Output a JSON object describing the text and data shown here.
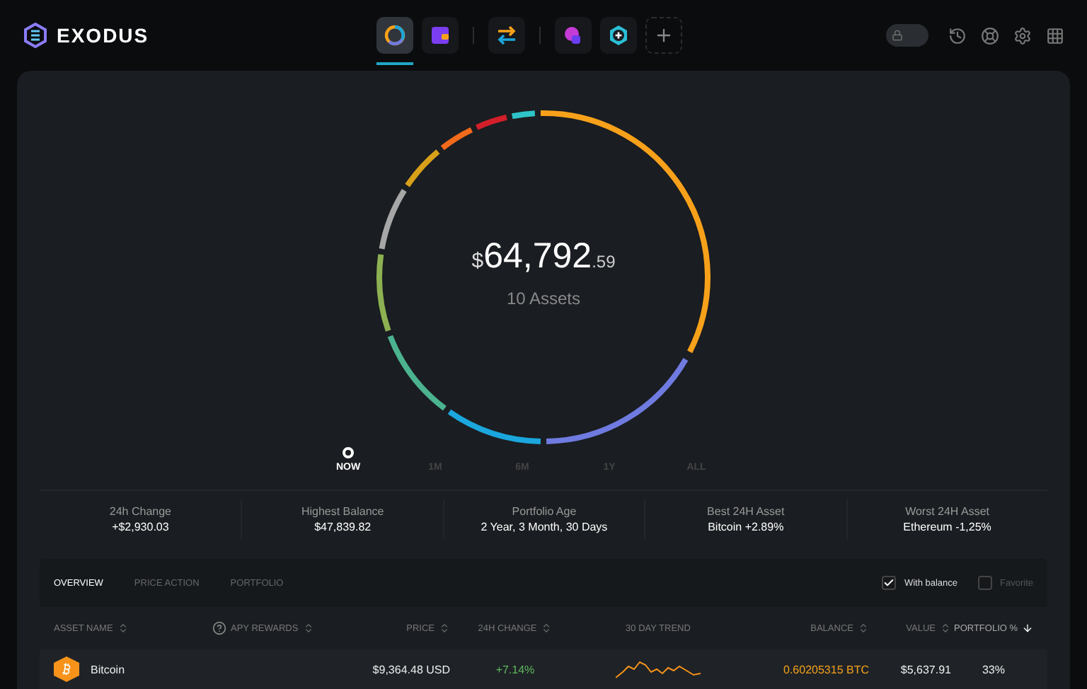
{
  "brand": {
    "name": "EXODUS"
  },
  "nav": [
    {
      "kind": "portfolio",
      "selected": true
    },
    {
      "kind": "wallet",
      "selected": false
    },
    {
      "kind": "divider"
    },
    {
      "kind": "exchange",
      "selected": false
    },
    {
      "kind": "divider"
    },
    {
      "kind": "app-pink",
      "selected": false
    },
    {
      "kind": "app-cyan",
      "selected": false
    },
    {
      "kind": "add"
    }
  ],
  "lock": {
    "on": false
  },
  "portfolio": {
    "currency": "$",
    "whole": "64,792",
    "cents": ".59",
    "assets": "10 Assets"
  },
  "timeline": [
    {
      "label": "NOW",
      "selected": true
    },
    {
      "label": "1M",
      "selected": false
    },
    {
      "label": "6M",
      "selected": false
    },
    {
      "label": "1Y",
      "selected": false
    },
    {
      "label": "ALL",
      "selected": false
    }
  ],
  "stats": [
    {
      "label": "24h Change",
      "value": "+$2,930.03"
    },
    {
      "label": "Highest Balance",
      "value": "$47,839.82"
    },
    {
      "label": "Portfolio Age",
      "value": "2 Year, 3 Month, 30 Days"
    },
    {
      "label": "Best 24H Asset",
      "value": "Bitcoin +2.89%"
    },
    {
      "label": "Worst 24H Asset",
      "value": "Ethereum -1,25%"
    }
  ],
  "table": {
    "tabs": [
      {
        "label": "OVERVIEW",
        "selected": true
      },
      {
        "label": "PRICE ACTION",
        "selected": false
      },
      {
        "label": "PORTFOLIO",
        "selected": false
      }
    ],
    "filters": [
      {
        "label": "With balance",
        "checked": true
      },
      {
        "label": "Favorite",
        "checked": false
      }
    ],
    "columns": [
      {
        "label": "ASSET NAME",
        "sortable": true,
        "sorted": false
      },
      {
        "label": "APY REWARDS",
        "sortable": true,
        "sorted": false,
        "help": true
      },
      {
        "label": "PRICE",
        "sortable": true,
        "sorted": false
      },
      {
        "label": "24H CHANGE",
        "sortable": true,
        "sorted": false
      },
      {
        "label": "30 DAY TREND",
        "sortable": false,
        "sorted": false
      },
      {
        "label": "BALANCE",
        "sortable": true,
        "sorted": false
      },
      {
        "label": "VALUE",
        "sortable": true,
        "sorted": false
      },
      {
        "label": "PORTFOLIO %",
        "sortable": true,
        "sorted": true
      }
    ],
    "rows": [
      {
        "name": "Bitcoin",
        "price": "$9,364.48 USD",
        "change": "+7.14%",
        "balance": "0.60205315 BTC",
        "value": "$5,637.91",
        "share": "33%",
        "color": "#f7931a"
      }
    ]
  }
}
